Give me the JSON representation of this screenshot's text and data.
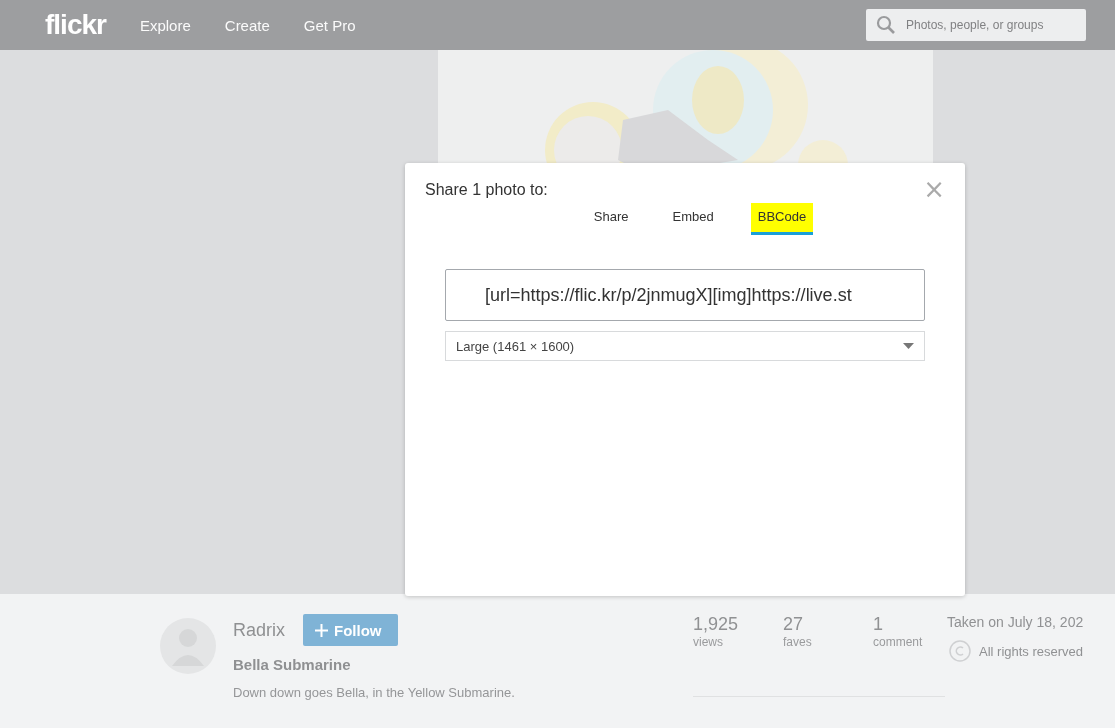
{
  "header": {
    "logo": "flickr",
    "nav": [
      "Explore",
      "Create",
      "Get Pro"
    ],
    "search": {
      "placeholder": "Photos, people, or groups"
    }
  },
  "dialog": {
    "title": "Share 1 photo to:",
    "close": "×",
    "tabs": [
      {
        "label": "Share",
        "selected": false
      },
      {
        "label": "Embed",
        "selected": false
      },
      {
        "label": "BBCode",
        "selected": true,
        "highlighted": true
      }
    ],
    "code": "[url=https://flic.kr/p/2jnmugX][img]https://live.st",
    "size": "Large (1461 × 1600)"
  },
  "info": {
    "author": "Radrix",
    "follow": "Follow",
    "title": "Bella Submarine",
    "description": "Down down goes Bella, in the Yellow Submarine.",
    "stats": [
      {
        "value": "1,925",
        "label": "views"
      },
      {
        "value": "27",
        "label": "faves"
      },
      {
        "value": "1",
        "label": "comment"
      }
    ],
    "taken": "Taken on July 18, 202",
    "license": "All rights reserved"
  }
}
